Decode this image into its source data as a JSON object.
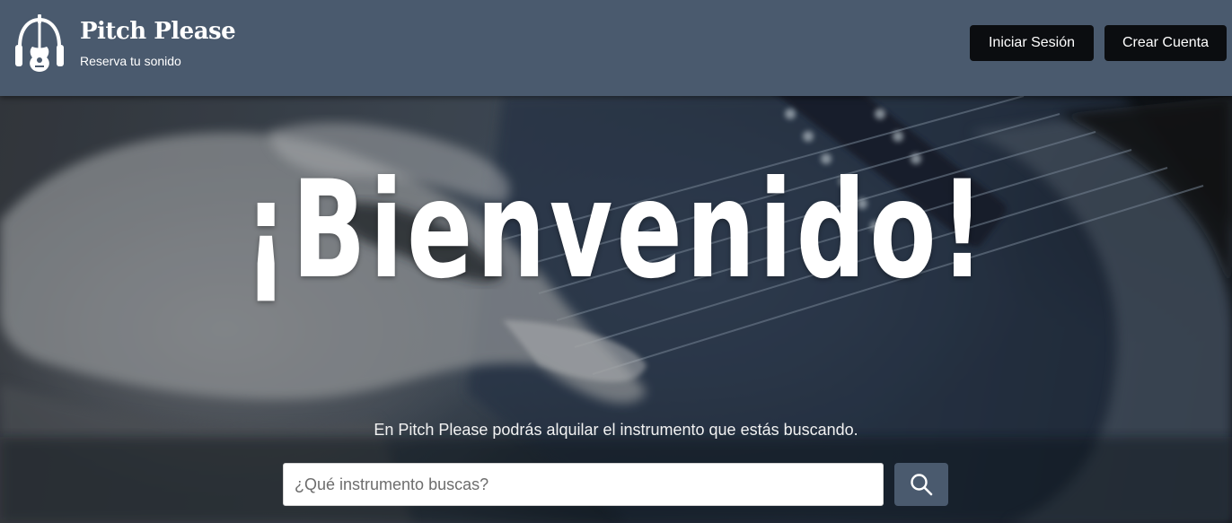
{
  "header": {
    "brand_title": "Pitch Please",
    "brand_subtitle": "Reserva tu sonido",
    "logo_icon": "guitar-headphones-icon",
    "login_label": "Iniciar Sesión",
    "register_label": "Crear Cuenta"
  },
  "hero": {
    "welcome_text": "¡Bienvenido!",
    "tagline": "En Pitch Please podrás alquilar el instrumento que estás buscando.",
    "search": {
      "placeholder": "¿Qué instrumento buscas?",
      "value": "",
      "button_icon": "search-icon"
    }
  },
  "colors": {
    "header_bg": "#4a5a6e",
    "button_bg": "#0b0d10",
    "search_button_bg": "#4a5a6e",
    "text": "#ffffff"
  }
}
